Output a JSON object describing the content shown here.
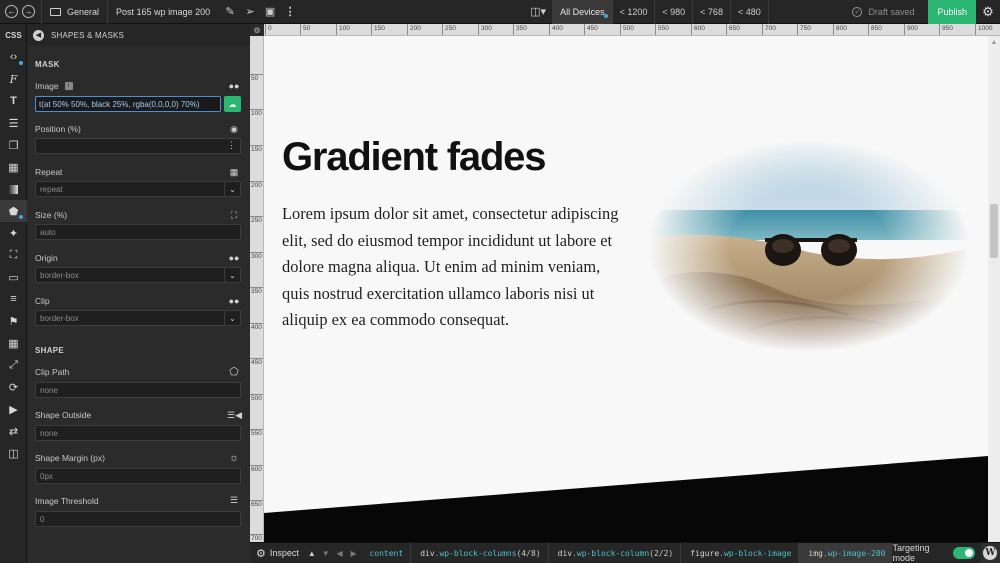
{
  "topbar": {
    "back_icon": "arrow-left-icon",
    "forward_icon": "arrow-right-icon",
    "folder_label": "General",
    "document_title": "Post 165 wp image 200",
    "devices": [
      "All Devices",
      "< 1200",
      "< 980",
      "< 768",
      "< 480"
    ],
    "status": "Draft saved",
    "publish_label": "Publish",
    "accent_color": "#2bb673"
  },
  "rail": {
    "css_label": "CSS",
    "icons": [
      "code-icon",
      "font-icon",
      "text-icon",
      "align-icon",
      "box-icon",
      "image-icon",
      "gradient-icon",
      "shape-mask-icon",
      "magic-wand-icon",
      "expand-icon",
      "layout-icon",
      "list-icon",
      "flag-icon",
      "grid-icon",
      "compress-icon",
      "transform-icon",
      "video-icon",
      "shuffle-icon",
      "inbox-icon"
    ]
  },
  "panel": {
    "header": "SHAPES & MASKS",
    "mask_section": "MASK",
    "image_label": "Image",
    "image_value": "t(at 50% 50%, black 25%, rgba(0,0,0,0) 70%)",
    "position_label": "Position (%)",
    "position_value": "",
    "repeat_label": "Repeat",
    "repeat_value": "repeat",
    "size_label": "Size (%)",
    "size_value": "auto",
    "origin_label": "Origin",
    "origin_value": "border-box",
    "clip_label": "Clip",
    "clip_value": "border-box",
    "shape_section": "SHAPE",
    "clip_path_label": "Clip Path",
    "clip_path_value": "none",
    "shape_outside_label": "Shape Outside",
    "shape_outside_value": "none",
    "shape_margin_label": "Shape Margin (px)",
    "shape_margin_value": "0px",
    "image_threshold_label": "Image Threshold",
    "image_threshold_value": "0"
  },
  "ruler": {
    "top": [
      "0",
      "50",
      "100",
      "150",
      "200",
      "250",
      "300",
      "350",
      "400",
      "450",
      "500",
      "550",
      "600",
      "650",
      "700",
      "750",
      "800",
      "850",
      "900",
      "950",
      "1000"
    ],
    "left": [
      "50",
      "100",
      "150",
      "200",
      "250",
      "300",
      "350",
      "400",
      "450",
      "500",
      "550",
      "600",
      "650",
      "700"
    ]
  },
  "canvas": {
    "heading": "Gradient fades",
    "paragraph": "Lorem ipsum dolor sit amet, consectetur adipiscing elit, sed do eiusmod tempor incididunt ut labore et dolore magna aliqua. Ut enim ad minim veniam, quis nostrud exercitation ullamco laboris nisi ut aliquip ex ea commodo consequat."
  },
  "bottombar": {
    "inspect_label": "Inspect",
    "crumbs": [
      {
        "tag": "",
        "cls": "content",
        "num": ""
      },
      {
        "tag": "div",
        "cls": ".wp-block-columns",
        "num": " (4/8)"
      },
      {
        "tag": "div",
        "cls": ".wp-block-column",
        "num": " (2/2)"
      },
      {
        "tag": "figure",
        "cls": ".wp-block-image",
        "num": ""
      },
      {
        "tag": "img",
        "cls": ".wp-image-200",
        "num": ""
      }
    ],
    "targeting_label": "Targeting mode"
  }
}
